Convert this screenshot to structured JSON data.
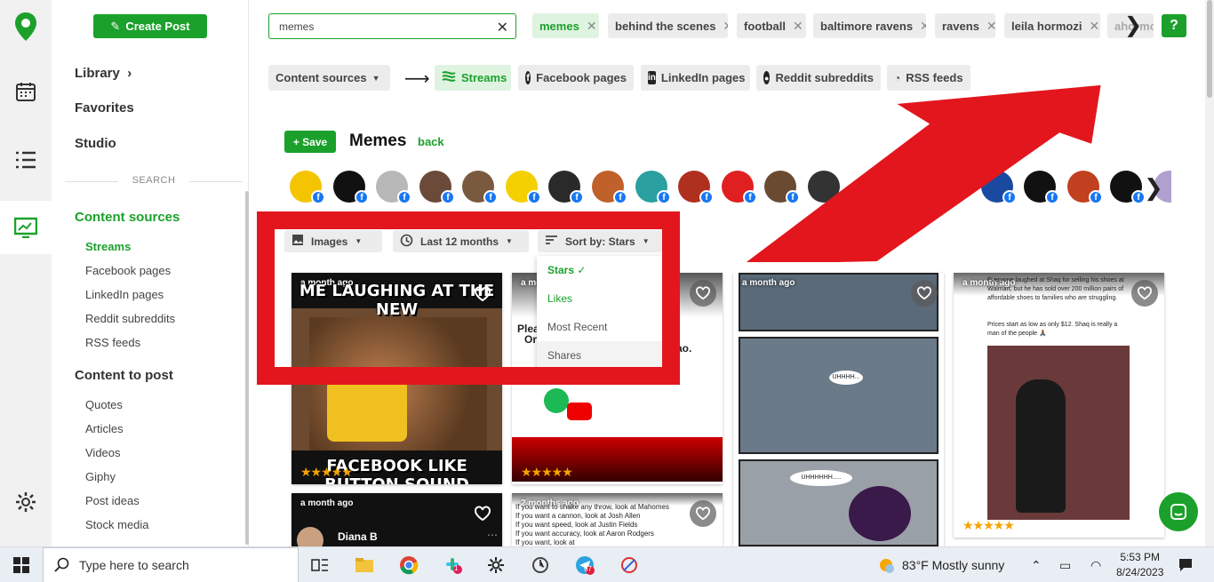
{
  "sidebar": {
    "create_label": "Create Post",
    "library": "Library",
    "favorites": "Favorites",
    "studio": "Studio",
    "search_label": "SEARCH",
    "content_sources": "Content sources",
    "sources": [
      "Streams",
      "Facebook pages",
      "LinkedIn pages",
      "Reddit subreddits",
      "RSS feeds"
    ],
    "content_to_post": "Content to post",
    "post_items": [
      "Quotes",
      "Articles",
      "Videos",
      "Giphy",
      "Post ideas",
      "Stock media"
    ]
  },
  "search": {
    "value": "memes",
    "chips": [
      "memes",
      "behind the scenes",
      "football",
      "baltimore ravens",
      "ravens",
      "leila hormozi",
      "ahormo"
    ],
    "help": "?"
  },
  "source_bar": {
    "dropdown": "Content sources",
    "tabs": [
      "Streams",
      "Facebook pages",
      "LinkedIn pages",
      "Reddit subreddits",
      "RSS feeds"
    ]
  },
  "stream": {
    "save_label": "+ Save",
    "title": "Memes",
    "back": "back"
  },
  "filters": {
    "type": "Images",
    "range": "Last 12 months",
    "sort": "Sort by: Stars",
    "sort_options": [
      "Stars",
      "Likes",
      "Most Recent",
      "Shares"
    ],
    "selected": "Stars"
  },
  "cards": [
    {
      "ago": "a month ago",
      "top": "ME LAUGHING AT THE NEW",
      "bottom": "FACEBOOK LIKE BUTTON SOUND",
      "stars": "★★★★★"
    },
    {
      "ago": "a month ago",
      "line1": "Plea",
      "line2": "Or",
      "line3": "ao.",
      "stars": "★★★★★"
    },
    {
      "ago": "a month ago",
      "bubble1": "UHHHH...",
      "bubble2": "UHHHHHH....."
    },
    {
      "ago": "a month ago",
      "text1": "Everyone laughed at Shaq for selling his shoes at Walmart, but he has sold over 200 million pairs of affordable shoes to families who are struggling.",
      "text2": "Prices start as low as only $12. Shaq is really a man of the people 🙏🏾",
      "stars": "★★★★★"
    },
    {
      "ago": "a month ago",
      "name": "Diana B"
    },
    {
      "ago": "2 months ago",
      "lines": [
        "If you want to shake any throw, look at Mahomes",
        "If you want a cannon, look at Josh Allen",
        "If you want speed, look at Justin Fields",
        "If you want accuracy, look at Aaron Rodgers",
        "If you want, look at"
      ]
    }
  ],
  "taskbar": {
    "search_placeholder": "Type here to search",
    "weather": "83°F  Mostly sunny",
    "time": "5:53 PM",
    "date": "8/24/2023",
    "badge_slack": "1",
    "badge_tg": "97"
  },
  "colors": {
    "brand": "#1ba12b",
    "annotation": "#e3161d",
    "facebook": "#1877f2"
  }
}
